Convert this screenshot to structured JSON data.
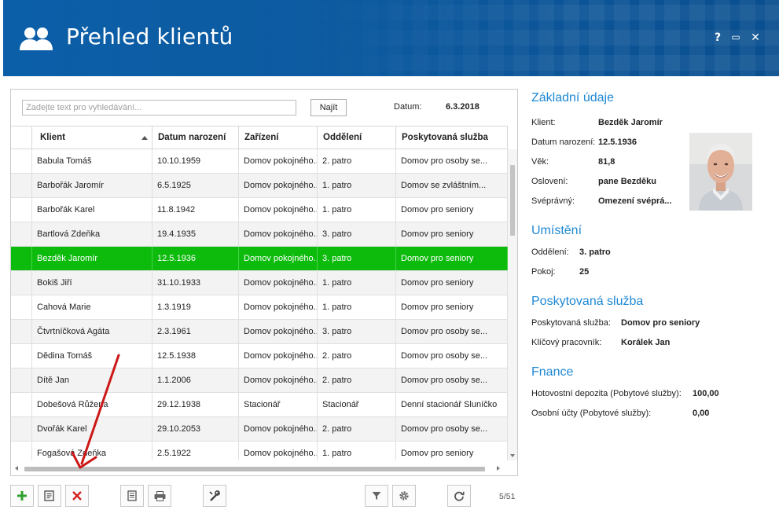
{
  "window": {
    "title": "Přehled klientů",
    "controls": {
      "help": "?",
      "maximize": "▭",
      "close": "✕"
    }
  },
  "search": {
    "placeholder": "Zadejte text pro vyhledávání...",
    "find_label": "Najít"
  },
  "date": {
    "label": "Datum:",
    "value": "6.3.2018"
  },
  "table": {
    "columns": [
      "Klient",
      "Datum narození",
      "Zařízení",
      "Oddělení",
      "Poskytovaná služba"
    ],
    "rows": [
      [
        "Babula Tomáš",
        "10.10.1959",
        "Domov pokojného...",
        "2. patro",
        "Domov pro osoby se..."
      ],
      [
        "Barbořák Jaromír",
        "6.5.1925",
        "Domov pokojného...",
        "1. patro",
        "Domov se zvláštním..."
      ],
      [
        "Barbořák Karel",
        "11.8.1942",
        "Domov pokojného...",
        "1. patro",
        "Domov pro seniory"
      ],
      [
        "Bartlová Zdeňka",
        "19.4.1935",
        "Domov pokojného...",
        "3. patro",
        "Domov pro seniory"
      ],
      [
        "Bezděk Jaromír",
        "12.5.1936",
        "Domov pokojného...",
        "3. patro",
        "Domov pro seniory"
      ],
      [
        "Bokiš Jiří",
        "31.10.1933",
        "Domov pokojného...",
        "1. patro",
        "Domov pro seniory"
      ],
      [
        "Cahová Marie",
        "1.3.1919",
        "Domov pokojného...",
        "1. patro",
        "Domov pro seniory"
      ],
      [
        "Čtvrtníčková Agáta",
        "2.3.1961",
        "Domov pokojného...",
        "3. patro",
        "Domov pro osoby se..."
      ],
      [
        "Dědina Tomáš",
        "12.5.1938",
        "Domov pokojného...",
        "2. patro",
        "Domov pro osoby se..."
      ],
      [
        "Dítě Jan",
        "1.1.2006",
        "Domov pokojného...",
        "2. patro",
        "Domov pro osoby se..."
      ],
      [
        "Dobešová Růžena",
        "29.12.1938",
        "Stacionář",
        "Stacionář",
        "Denní stacionář Sluníčko"
      ],
      [
        "Dvořák Karel",
        "29.10.2053",
        "Domov pokojného...",
        "2. patro",
        "Domov pro osoby se..."
      ],
      [
        "Fogašová Zdeňka",
        "2.5.1922",
        "Domov pokojného...",
        "1. patro",
        "Domov pro seniory"
      ]
    ],
    "selected_index": 4
  },
  "toolbar": {
    "counter": "5/51"
  },
  "detail": {
    "basic": {
      "title": "Základní údaje",
      "client_label": "Klient:",
      "client_value": "Bezděk Jaromír",
      "birth_label": "Datum narození:",
      "birth_value": "12.5.1936",
      "age_label": "Věk:",
      "age_value": "81,8",
      "salutation_label": "Oslovení:",
      "salutation_value": "pane Bezděku",
      "competence_label": "Svéprávný:",
      "competence_value": "Omezení svéprá..."
    },
    "placement": {
      "title": "Umístění",
      "department_label": "Oddělení:",
      "department_value": "3. patro",
      "room_label": "Pokoj:",
      "room_value": "25"
    },
    "service": {
      "title": "Poskytovaná služba",
      "service_label": "Poskytovaná služba:",
      "service_value": "Domov pro seniory",
      "worker_label": "Klíčový pracovník:",
      "worker_value": "Korálek Jan"
    },
    "finance": {
      "title": "Fnance",
      "deposit_label": "Hotovostní depozita (Pobytové služby):",
      "deposit_value": "100,00",
      "accounts_label": "Osobní účty (Pobytové služby):",
      "accounts_value": "0,00"
    }
  },
  "colors": {
    "header": "#0b5fa8",
    "selected_row": "#0dbb0d",
    "section_title": "#1e88d3",
    "add": "#2ea12e",
    "delete": "#d42020"
  }
}
